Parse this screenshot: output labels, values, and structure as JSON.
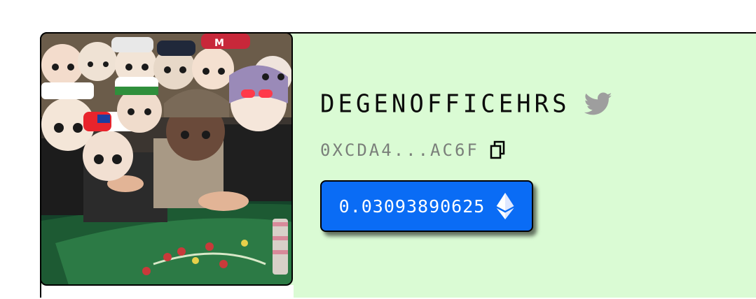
{
  "profile": {
    "name": "DEGENOFFICEHRS",
    "address": "0XCDA4...AC6F",
    "balance": "0.03093890625"
  },
  "icons": {
    "twitter": "twitter-icon",
    "copy": "copy-icon",
    "eth": "ethereum-icon"
  },
  "colors": {
    "card_background": "#dafbd4",
    "balance_button": "#0a6cf5",
    "address_text": "#7a7f7a",
    "twitter_icon": "#9e9e9e"
  }
}
